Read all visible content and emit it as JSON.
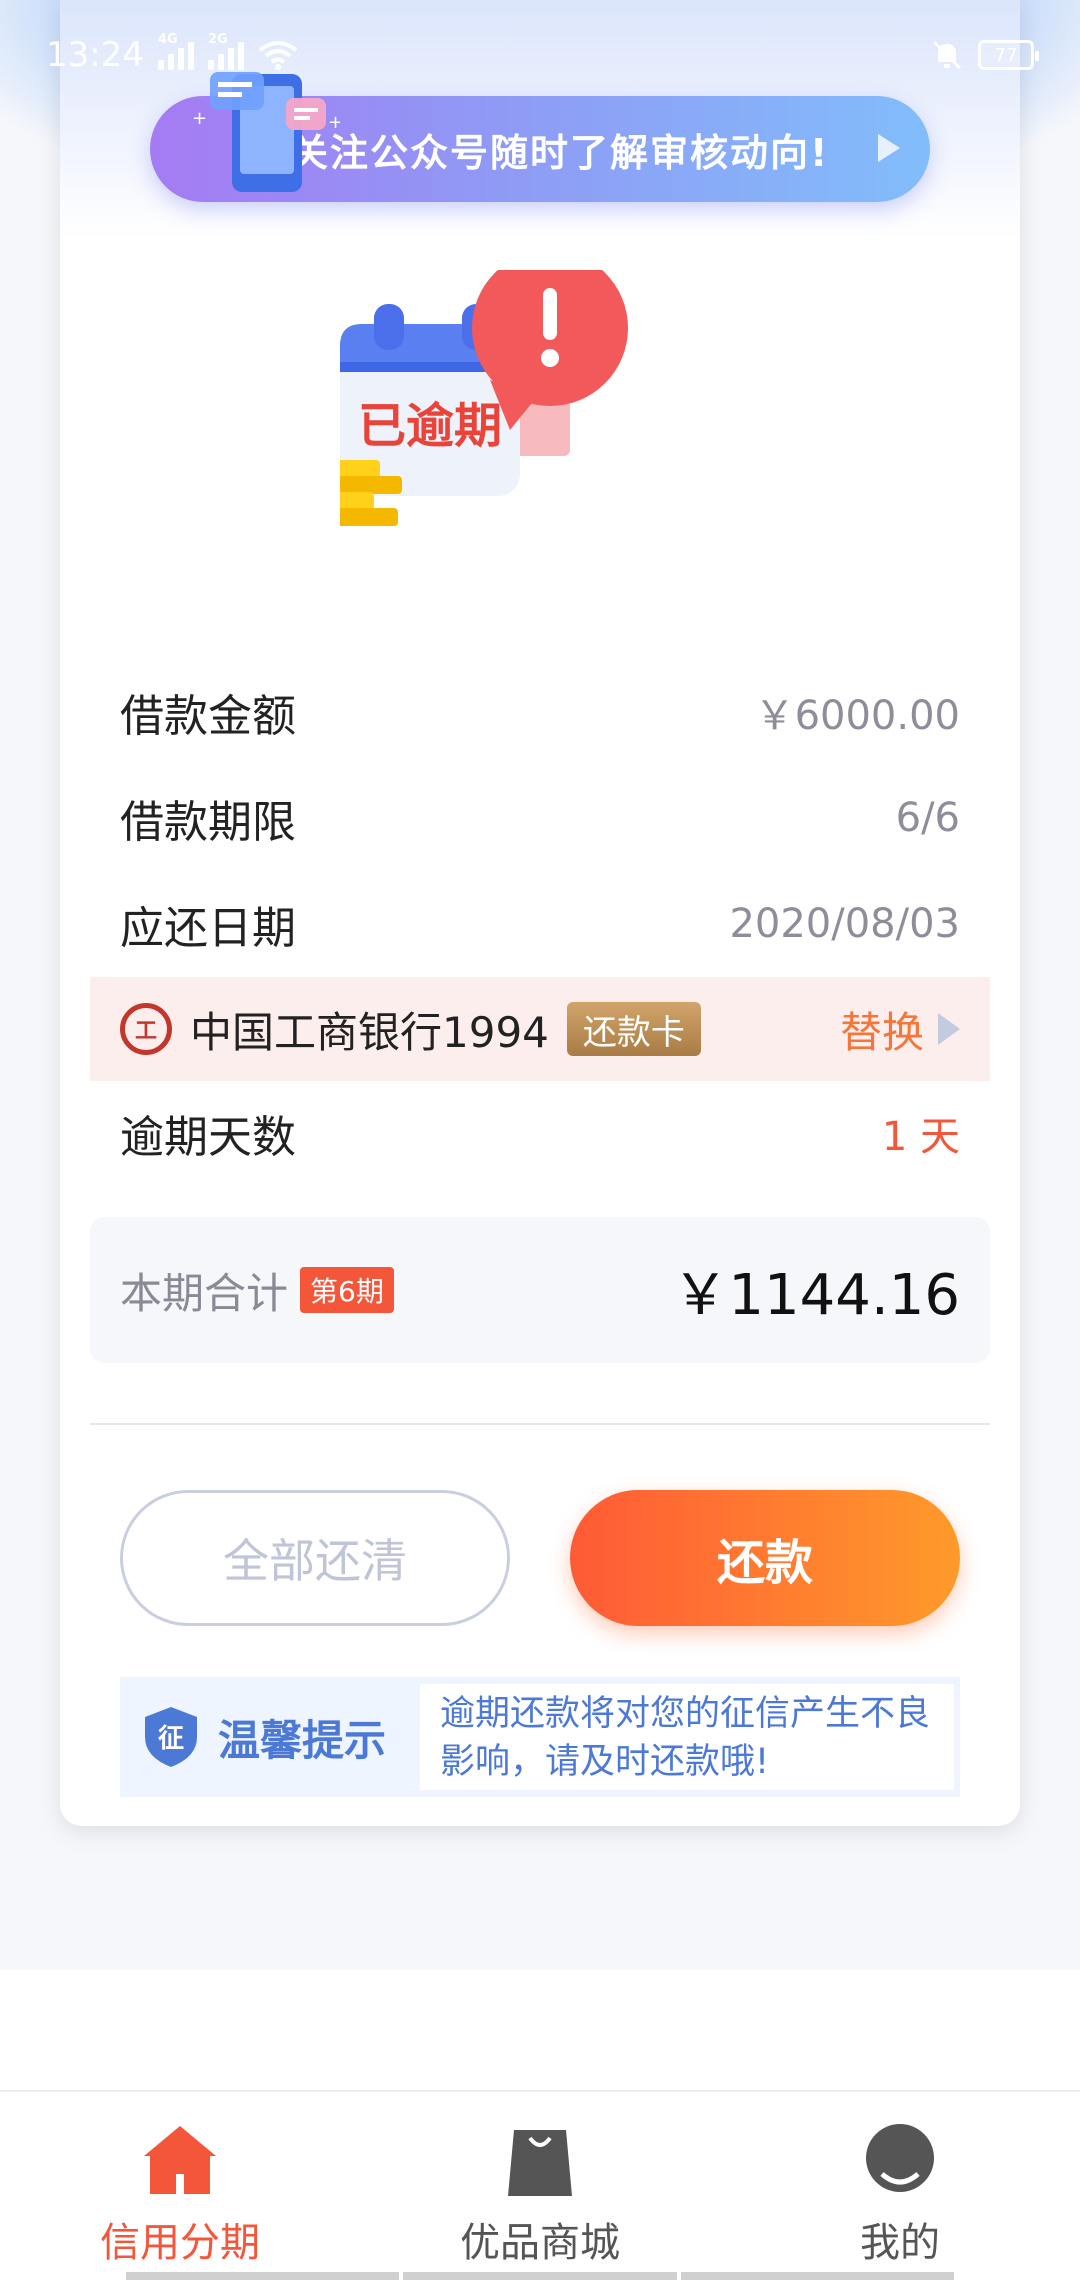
{
  "status_bar": {
    "time": "13:24",
    "net1": "4G",
    "net2": "2G",
    "battery": "77"
  },
  "banner": {
    "text": "关注公众号随时了解审核动向!"
  },
  "illustration": {
    "label": "已逾期"
  },
  "loan": {
    "amount_label": "借款金额",
    "amount_value": "￥6000.00",
    "term_label": "借款期限",
    "term_value": "6/6",
    "due_label": "应还日期",
    "due_value": "2020/08/03"
  },
  "bank": {
    "logo": "工",
    "name": "中国工商银行1994",
    "badge": "还款卡",
    "replace": "替换"
  },
  "overdue": {
    "label": "逾期天数",
    "value": "1 天"
  },
  "total": {
    "label": "本期合计",
    "period": "第6期",
    "value": "￥1144.16"
  },
  "buttons": {
    "clear_all": "全部还清",
    "repay": "还款"
  },
  "tip": {
    "icon_text": "征",
    "title": "温馨提示",
    "text": "逾期还款将对您的征信产生不良影响，请及时还款哦!"
  },
  "nav": {
    "items": [
      {
        "label": "信用分期",
        "icon": "home-icon",
        "active": true
      },
      {
        "label": "优品商城",
        "icon": "shopping-bag-icon",
        "active": false
      },
      {
        "label": "我的",
        "icon": "profile-icon",
        "active": false
      }
    ]
  },
  "colors": {
    "accent": "#f4563a",
    "repay_gradient_start": "#ff5a36",
    "repay_gradient_end": "#ff9a2a",
    "tip_blue": "#4d79d6"
  }
}
